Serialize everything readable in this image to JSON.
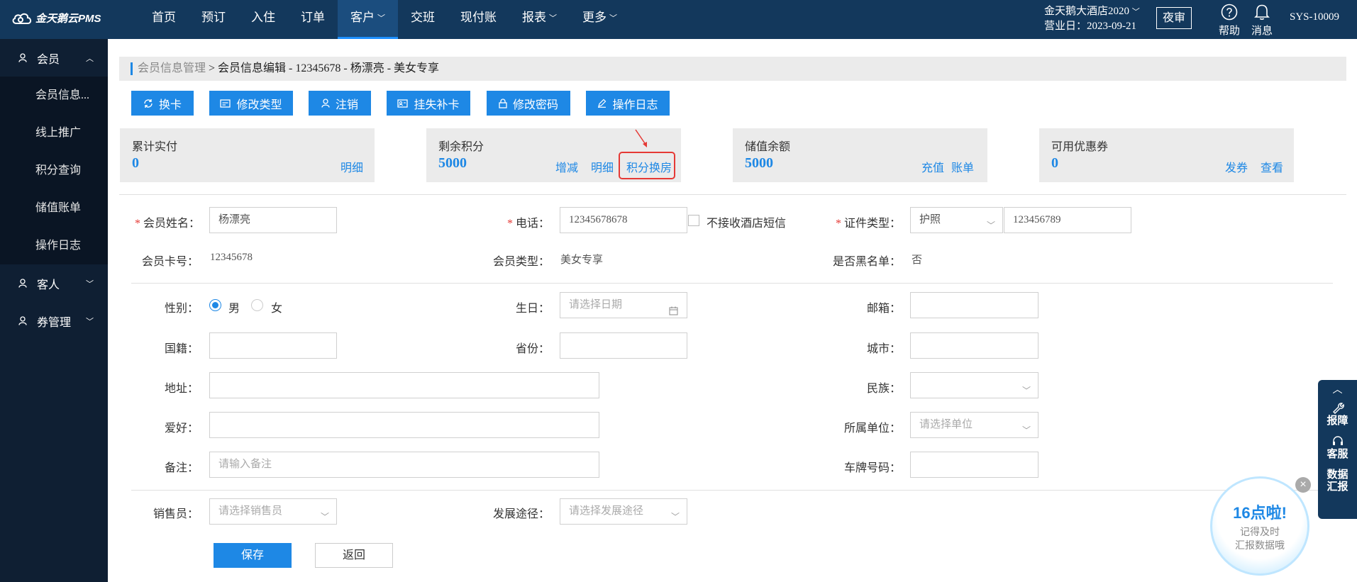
{
  "app": {
    "logo_text": "金天鹅云PMS"
  },
  "nav": [
    {
      "label": "首页"
    },
    {
      "label": "预订"
    },
    {
      "label": "入住"
    },
    {
      "label": "订单"
    },
    {
      "label": "客户",
      "active": true
    },
    {
      "label": "交班"
    },
    {
      "label": "现付账"
    },
    {
      "label": "报表"
    },
    {
      "label": "更多"
    }
  ],
  "header": {
    "hotel_name": "金天鹅大酒店2020",
    "business_date": "营业日：2023-09-21",
    "night_audit": "夜审",
    "help": "帮助",
    "messages": "消息",
    "user": "SYS-10009"
  },
  "sidebar": {
    "member_group": "会员",
    "member_items": [
      "会员信息...",
      "线上推广",
      "积分查询",
      "储值账单",
      "操作日志"
    ],
    "guest_group": "客人",
    "coupon_group": "券管理"
  },
  "breadcrumb": {
    "parent": "会员信息管理",
    "current": " > 会员信息编辑 - 12345678 - 杨漂亮 - 美女专享"
  },
  "actions": [
    {
      "label": "换卡",
      "icon": "refresh-icon"
    },
    {
      "label": "修改类型",
      "icon": "card-icon"
    },
    {
      "label": "注销",
      "icon": "user-icon"
    },
    {
      "label": "挂失补卡",
      "icon": "id-card-icon"
    },
    {
      "label": "修改密码",
      "icon": "lock-icon"
    },
    {
      "label": "操作日志",
      "icon": "edit-icon"
    }
  ],
  "cards": {
    "paid": {
      "title": "累计实付",
      "value": "0",
      "link1": "明细"
    },
    "points": {
      "title": "剩余积分",
      "value": "5000",
      "link1": "增减",
      "link2": "明细",
      "link3": "积分换房"
    },
    "balance": {
      "title": "储值余额",
      "value": "5000",
      "link1": "充值",
      "link2": "账单"
    },
    "coupons": {
      "title": "可用优惠券",
      "value": "0",
      "link1": "发券",
      "link2": "查看"
    }
  },
  "form": {
    "name_label": "会员姓名：",
    "name_value": "杨漂亮",
    "phone_label": "电话：",
    "phone_value": "12345678678",
    "no_sms_label": "不接收酒店短信",
    "id_type_label": "证件类型：",
    "id_type_value": "护照",
    "id_number_value": "123456789",
    "card_no_label": "会员卡号：",
    "card_no_value": "12345678",
    "member_type_label": "会员类型：",
    "member_type_value": "美女专享",
    "blacklist_label": "是否黑名单：",
    "blacklist_value": "否",
    "gender_label": "性别：",
    "gender_male": "男",
    "gender_female": "女",
    "birthday_label": "生日：",
    "birthday_placeholder": "请选择日期",
    "email_label": "邮箱：",
    "nationality_label": "国籍：",
    "province_label": "省份：",
    "city_label": "城市：",
    "address_label": "地址：",
    "ethnic_label": "民族：",
    "hobby_label": "爱好：",
    "company_label": "所属单位：",
    "company_placeholder": "请选择单位",
    "remark_label": "备注：",
    "remark_placeholder": "请输入备注",
    "plate_label": "车牌号码：",
    "sales_label": "销售员：",
    "sales_placeholder": "请选择销售员",
    "channel_label": "发展途径：",
    "channel_placeholder": "请选择发展途径",
    "save": "保存",
    "back": "返回"
  },
  "float_panel": {
    "report": "报障",
    "service": "客服",
    "data_line1": "数据",
    "data_line2": "汇报"
  },
  "bubble": {
    "title": "16点啦!",
    "line1": "记得及时",
    "line2": "汇报数据哦"
  }
}
